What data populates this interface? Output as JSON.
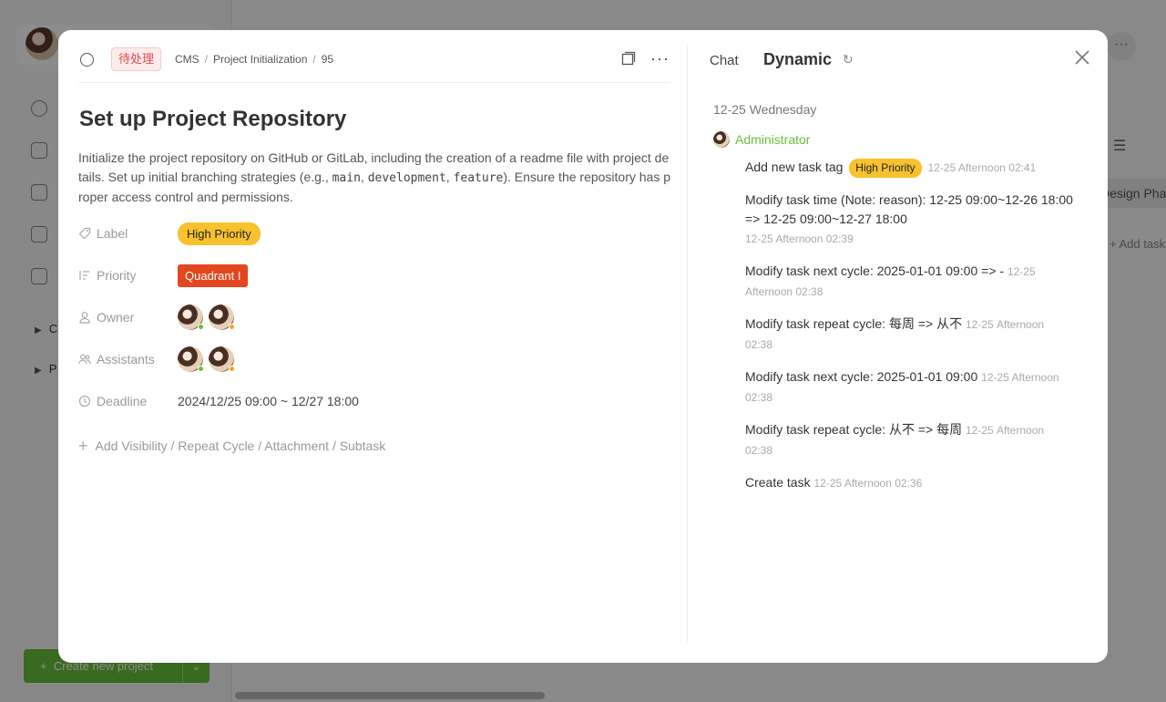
{
  "background": {
    "tree": [
      "C",
      "P"
    ],
    "create_button": "Create new project",
    "column_header": "Design Phase",
    "add_task": "Add task"
  },
  "header": {
    "status": "待处理",
    "breadcrumb": [
      "CMS",
      "Project Initialization",
      "95"
    ]
  },
  "task": {
    "title": "Set up Project Repository",
    "description_parts": [
      "Initialize the project repository on GitHub or GitLab, including the creation of a readme file with project details. Set up initial branching strategies (e.g., ",
      "main",
      ", ",
      "development",
      ", ",
      "feature",
      "). Ensure the repository has proper access control and permissions."
    ],
    "fields": {
      "label": {
        "name": "Label",
        "value": "High Priority"
      },
      "priority": {
        "name": "Priority",
        "value": "Quadrant I"
      },
      "owner": {
        "name": "Owner",
        "status_colors": [
          "#67c23a",
          "#f5a623"
        ]
      },
      "assistants": {
        "name": "Assistants",
        "status_colors": [
          "#67c23a",
          "#f5a623"
        ]
      },
      "deadline": {
        "name": "Deadline",
        "value": "2024/12/25 09:00 ~ 12/27 18:00"
      }
    },
    "add_more": "Add Visibility / Repeat Cycle / Attachment / Subtask"
  },
  "activity": {
    "tabs": {
      "chat": "Chat",
      "dynamic": "Dynamic"
    },
    "date": "12-25 Wednesday",
    "actor": "Administrator",
    "entries": [
      {
        "text": "Add new task tag",
        "tag": "High Priority",
        "time": "12-25 Afternoon 02:41"
      },
      {
        "text": "Modify task time (Note: reason): 12-25 09:00~12-26 18:00 => 12-25 09:00~12-27 18:00",
        "time": "12-25 Afternoon 02:39",
        "time_newline": true
      },
      {
        "text": "Modify task next cycle: 2025-01-01 09:00 => -",
        "time": "12-25 Afternoon 02:38"
      },
      {
        "text": "Modify task repeat cycle: 每周 => 从不",
        "time": "12-25 Afternoon 02:38"
      },
      {
        "text": "Modify task next cycle: 2025-01-01 09:00",
        "time": "12-25 Afternoon 02:38"
      },
      {
        "text": "Modify task repeat cycle: 从不 => 每周",
        "time": "12-25 Afternoon 02:38"
      },
      {
        "text": "Create task",
        "time": "12-25 Afternoon 02:36"
      }
    ]
  },
  "colors": {
    "accent_green": "#67c23a",
    "tag_yellow": "#f7c22e",
    "priority_red": "#e2471f",
    "status_red": "#e5484d"
  }
}
